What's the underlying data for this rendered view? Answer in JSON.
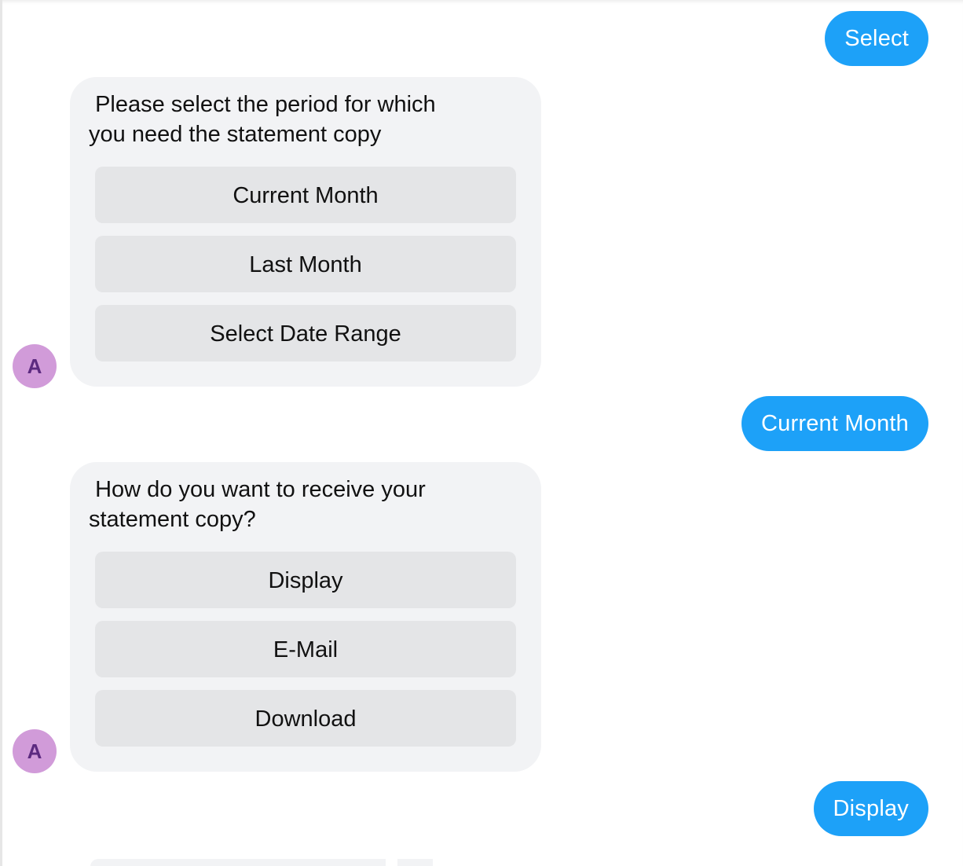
{
  "colors": {
    "user_bubble": "#1da1f8",
    "bot_bubble": "#f2f3f5",
    "quick_reply_bg": "#e4e5e7",
    "avatar_bg": "#d19bd9",
    "avatar_text": "#5c2a80"
  },
  "messages": [
    {
      "type": "user",
      "text": "Select"
    },
    {
      "type": "bot",
      "avatar_initial": "A",
      "text": " Please select the period for which\nyou need the statement copy",
      "quick_replies": [
        "Current Month",
        "Last Month",
        "Select Date Range"
      ]
    },
    {
      "type": "user",
      "text": "Current Month"
    },
    {
      "type": "bot",
      "avatar_initial": "A",
      "text": " How do you want to receive your\nstatement copy?",
      "quick_replies": [
        "Display",
        "E-Mail",
        "Download"
      ]
    },
    {
      "type": "user",
      "text": "Display"
    }
  ]
}
